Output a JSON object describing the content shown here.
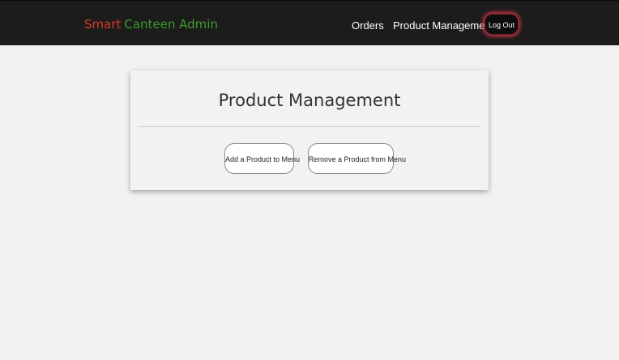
{
  "navbar": {
    "brand_part1": "Smart",
    "brand_part2": "Canteen Admin",
    "links": {
      "orders": "Orders",
      "product_management": "Product Management"
    },
    "logout_label": "Log Out"
  },
  "card": {
    "title": "Product Management",
    "buttons": {
      "add": "Add a Product to Menu",
      "remove": "Remove a Product from Menu"
    }
  },
  "colors": {
    "navbar_bg": "#1c1c1c",
    "brand_red": "#d93a2b",
    "brand_green": "#3f9a2e",
    "logout_glow": "#d0354a",
    "page_bg": "#f2f2f2"
  }
}
